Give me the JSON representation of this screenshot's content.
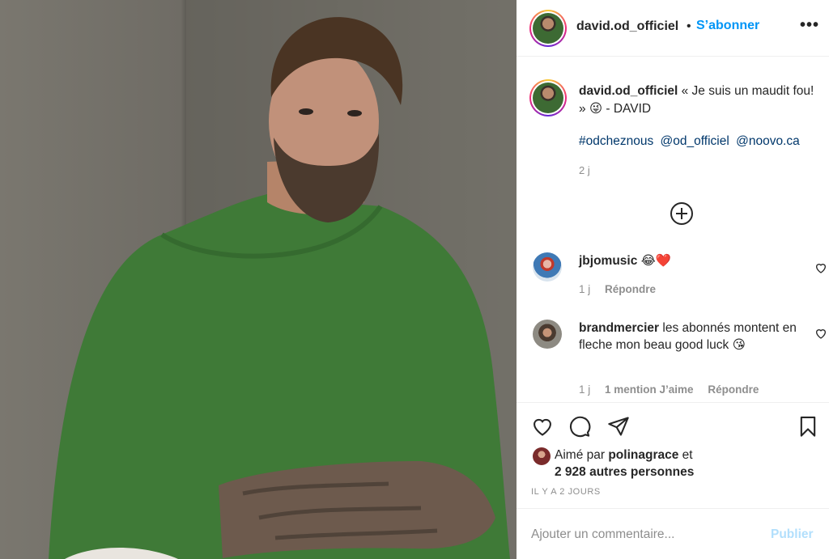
{
  "post": {
    "author": "david.od_officiel",
    "follow_label": "S’abonner",
    "separator": "•",
    "more_label": "•••",
    "caption": "« Je suis un maudit fou! » 😜 - DAVID",
    "hashtags": [
      "#odcheznous",
      "@od_officiel",
      "@noovo.ca"
    ],
    "caption_time": "2 j"
  },
  "comments": [
    {
      "user": "jbjomusic",
      "text": "😂❤️",
      "time": "1 j",
      "likes_label": "",
      "reply_label": "Répondre"
    },
    {
      "user": "brandmercier",
      "text": "les abonnés montent en fleche mon beau good luck 😘",
      "time": "1 j",
      "likes_label": "1 mention J’aime",
      "reply_label": "Répondre"
    }
  ],
  "likes": {
    "prefix": "Aimé par",
    "user": "polinagrace",
    "suffix": "et",
    "others": "2 928 autres personnes"
  },
  "post_date": "IL Y A 2 JOURS",
  "comment_box": {
    "placeholder": "Ajouter un commentaire...",
    "publish_label": "Publier"
  },
  "icons": {
    "like": "heart-icon",
    "comment": "comment-icon",
    "share": "paper-plane-icon",
    "save": "bookmark-icon",
    "more": "ellipsis-icon",
    "load_more": "plus-circle-icon"
  },
  "colors": {
    "link_blue": "#0095f6",
    "hashtag_blue": "#00376b",
    "muted": "#8e8e8e",
    "sweater_green": "#3f7a37"
  }
}
